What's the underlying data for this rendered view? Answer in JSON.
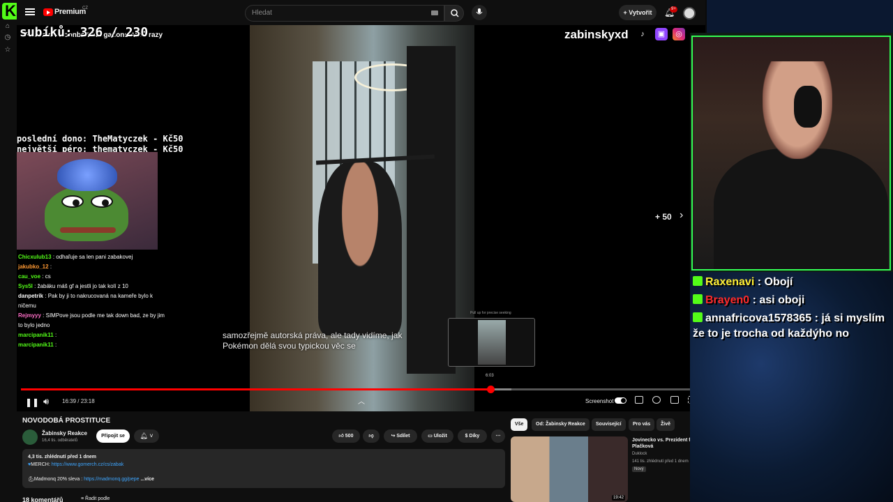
{
  "brand": {
    "name": "Premium",
    "country": "CZ"
  },
  "search": {
    "placeholder": "Hledat"
  },
  "header": {
    "create_label": "Vytvořit",
    "notif_count": "9+"
  },
  "overlay": {
    "video_title": "Pokémon Goonbait Allegations Are Crazy",
    "sub_counter": "subíků: 326 / 230",
    "handle": "zabinskyxd",
    "last_donation": "poslední dono: TheMatyczek - Kč50",
    "biggest_donation": "největší péro: thematyczek - Kč50"
  },
  "stream_chat": [
    {
      "user": "Chicxulub13",
      "msg": ": odhaľuje sa len pani zabakovej",
      "color": "#53fc18"
    },
    {
      "user": "jakubko_12",
      "msg": ":",
      "color": "#ff9933"
    },
    {
      "user": "cau_voe",
      "msg": ": cs",
      "color": "#53fc18"
    },
    {
      "user": "Sys5l",
      "msg": ": žabáku máš gf a jestli jo tak kolí z 10",
      "color": "#53fc18"
    },
    {
      "user": "danpetrik",
      "msg": ": Pak by ji to nakrucovaná na kameře bylo k ničemu",
      "color": "#ffffff"
    },
    {
      "user": "Rejmyyy",
      "msg": ": SIMPove jsou podle me tak down bad, ze by jim to bylo jedno",
      "color": "#ff6ec7"
    },
    {
      "user": "marcipanik11",
      "msg": ":",
      "color": "#53fc18"
    },
    {
      "user": "marcipanik11",
      "msg": ":",
      "color": "#53fc18"
    }
  ],
  "player": {
    "caption_line1": "samozřejmě autorská práva, ale tady vidíme, jak",
    "caption_line2": "Pokémon dělá svou typickou věc se",
    "skip_label": "+ 50",
    "time": "16:39 / 23:18",
    "preview_hint": "Pull up for precise seeking",
    "preview_time": "6:03",
    "progress_fraction": 0.69,
    "buffer_fraction": 0.72,
    "screenshot_label": "Screenshot"
  },
  "video": {
    "title": "NOVODOBÁ PROSTITUCE",
    "channel": "Žabinsky Reakce",
    "subs": "16,4 tis. odběratelů",
    "join_label": "Připojit se",
    "likes": "500",
    "share_label": "Sdílet",
    "save_label": "Uložit",
    "thanks_label": "Díky",
    "views_line": "4,3 tis. zhlédnutí  před 1 dnem",
    "merch_label": "MERCH:",
    "merch_link": "https://www.gomerch.cz/cs/zabak",
    "madmonq_label": "Madmonq 20% sleva :",
    "madmonq_link": "https://madmonq.gg/pepe",
    "more_label": "...více",
    "comments": "18 komentářů",
    "sort_label": "Řadit podle"
  },
  "chips": [
    "Vše",
    "Od: Žabinsky Reakce",
    "Související",
    "Pro vás",
    "Živě"
  ],
  "recommendation": {
    "title": "Jovinecko vs. Prezident ft. Plačková",
    "channel": "Duklock",
    "meta": "141 tis. zhlédnutí  před 1 dnem",
    "badge": "Nový",
    "duration": "19:42"
  },
  "right_chat": [
    {
      "user": "Raxenavi",
      "msg": ": Obojí",
      "color": "#ffee33"
    },
    {
      "user": "Brayen0",
      "msg": ": asi oboji",
      "color": "#ff2a2a"
    },
    {
      "user": "annafricova1578365",
      "msg": ": já si myslím že to je trocha od každýho no",
      "color": "#ffffff"
    }
  ],
  "colors": {
    "accent": "#ff0000",
    "kick": "#53fc18",
    "cam_border": "#33ff55"
  }
}
